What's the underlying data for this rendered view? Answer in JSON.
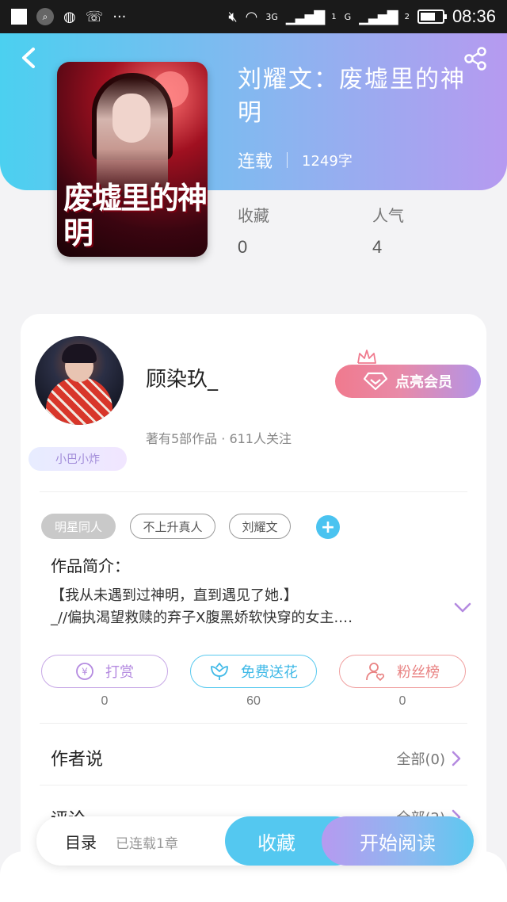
{
  "status_bar": {
    "time": "08:36",
    "net_3g": "3G",
    "net_g": "G",
    "sim1": "1",
    "sim2": "2",
    "more": "···"
  },
  "book": {
    "title": "刘耀文：废墟里的神明",
    "status": "连载",
    "word_count": "1249字",
    "cover_title_art": "废墟里的神明",
    "stats": [
      {
        "label": "收藏",
        "value": "0"
      },
      {
        "label": "人气",
        "value": "4"
      }
    ]
  },
  "author": {
    "name": "顾染玖_",
    "info": "著有5部作品 · 611人关注",
    "tag": "小巴小炸",
    "vip_label": "点亮会员"
  },
  "tags": [
    "明星同人",
    "不上升真人",
    "刘耀文"
  ],
  "intro": {
    "title": "作品简介：",
    "line1": "【我从未遇到过神明，直到遇见了她.】",
    "line2": "_//偏执渴望救赎的弃子X腹黑娇软快穿的女主.…"
  },
  "actions": [
    {
      "label": "打赏",
      "count": "0"
    },
    {
      "label": "免费送花",
      "count": "60"
    },
    {
      "label": "粉丝榜",
      "count": "0"
    }
  ],
  "sections": {
    "author_say": {
      "label": "作者说",
      "right": "全部(0)"
    },
    "comments": {
      "label": "评论",
      "right": "全部(2)"
    }
  },
  "bottom_bar": {
    "toc_label": "目录",
    "toc_status": "已连载1章",
    "favorite_label": "收藏",
    "read_label": "开始阅读"
  },
  "colors": {
    "accent_blue": "#54c8f0",
    "accent_purple": "#b69af0",
    "accent_pink": "#f07a8e"
  }
}
